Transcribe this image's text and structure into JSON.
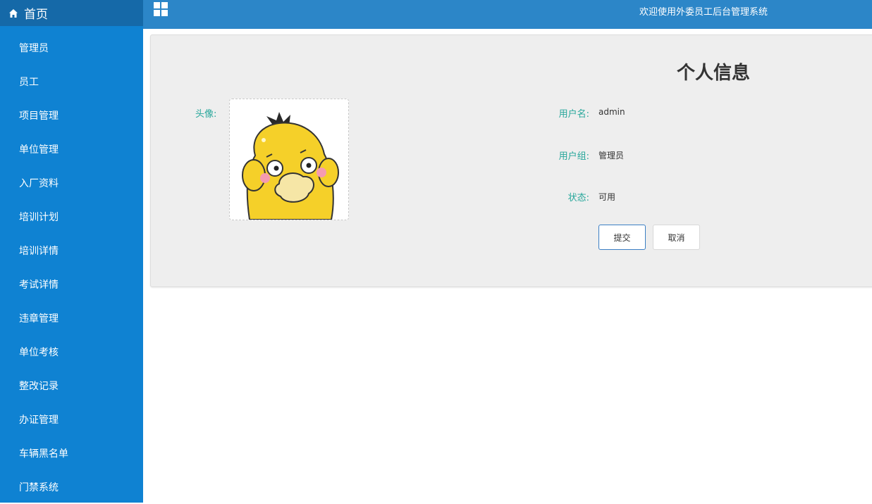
{
  "sidebar": {
    "home_label": "首页",
    "items": [
      {
        "label": "管理员"
      },
      {
        "label": "员工"
      },
      {
        "label": "项目管理"
      },
      {
        "label": "单位管理"
      },
      {
        "label": "入厂资料"
      },
      {
        "label": "培训计划"
      },
      {
        "label": "培训详情"
      },
      {
        "label": "考试详情"
      },
      {
        "label": "违章管理"
      },
      {
        "label": "单位考核"
      },
      {
        "label": "整改记录"
      },
      {
        "label": "办证管理"
      },
      {
        "label": "车辆黑名单"
      },
      {
        "label": "门禁系统"
      }
    ]
  },
  "topbar": {
    "welcome": "欢迎使用外委员工后台管理系统",
    "menu_icon": "grid-icon"
  },
  "profile": {
    "title": "个人信息",
    "avatar_label": "头像:",
    "fields": [
      {
        "label": "用户名:",
        "value": "admin"
      },
      {
        "label": "用户组:",
        "value": "管理员"
      },
      {
        "label": "状态:",
        "value": "可用"
      }
    ],
    "submit_label": "提交",
    "cancel_label": "取消"
  },
  "colors": {
    "sidebar": "#0f82d2",
    "sidebar_home": "#1569a8",
    "topbar": "#2c86c8",
    "label_teal": "#26a69a"
  }
}
